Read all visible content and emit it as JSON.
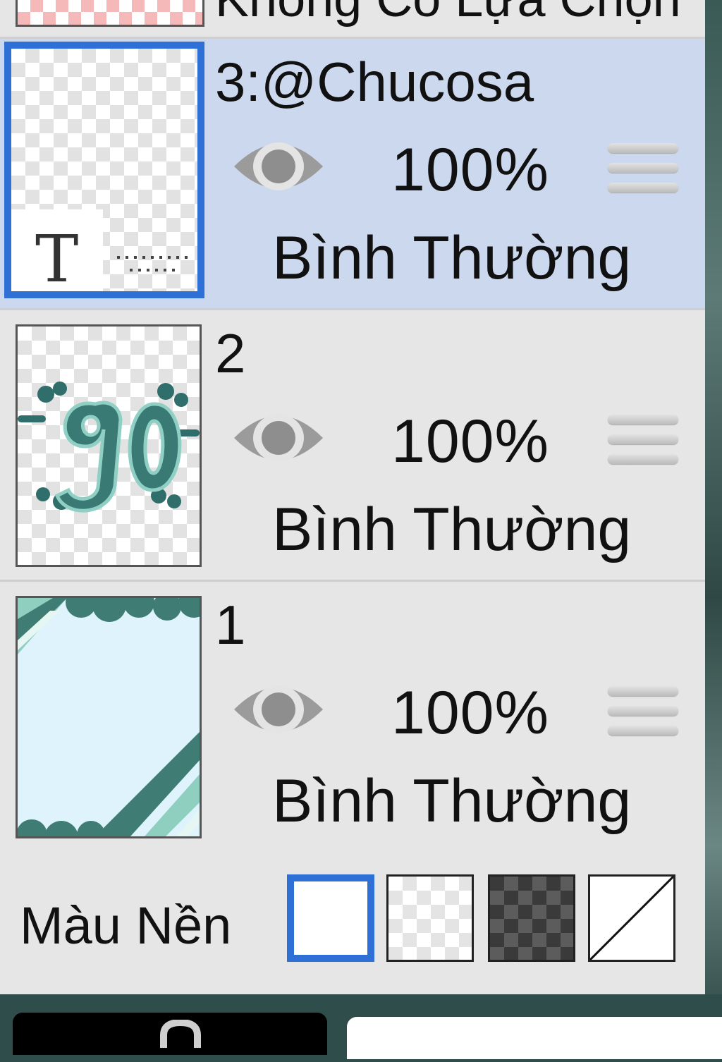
{
  "top_layer": {
    "title": "Không Có Lựa Chọn"
  },
  "layers": [
    {
      "name": "3:@Chucosa",
      "opacity": "100%",
      "blend": "Bình Thường",
      "selected": true,
      "thumbnail": "text-layer-thumbnail",
      "thumb_glyph": "T"
    },
    {
      "name": "2",
      "opacity": "100%",
      "blend": "Bình Thường",
      "selected": false,
      "thumbnail": "90-lettering-thumbnail"
    },
    {
      "name": "1",
      "opacity": "100%",
      "blend": "Bình Thường",
      "selected": false,
      "thumbnail": "light-blue-frame-thumbnail"
    }
  ],
  "background": {
    "label": "Màu Nền",
    "options": [
      "white",
      "light-checker",
      "dark-checker",
      "none"
    ],
    "selected": "white"
  },
  "colors": {
    "selected_row": "#cbd8ee",
    "accent": "#2e70d6",
    "panel": "#e6e6e6"
  }
}
